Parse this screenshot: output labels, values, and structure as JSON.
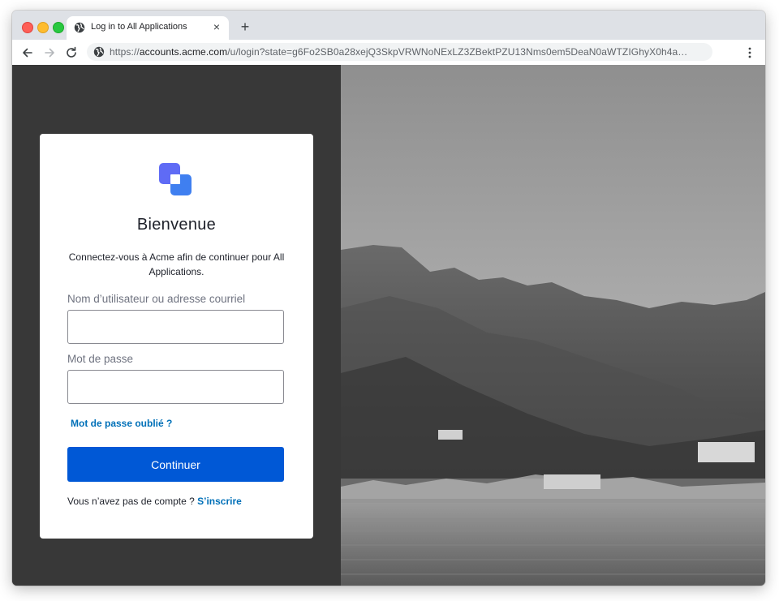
{
  "browser": {
    "tab_title": "Log in to All Applications",
    "close_tab_glyph": "×",
    "new_tab_glyph": "+",
    "url_prefix": "https://",
    "url_host": "accounts.acme.com",
    "url_path": "/u/login?state=g6Fo2SB0a28xejQ3SkpVRWNoNExLZ3ZBektPZU13Nms0em5DeaN0aWTZIGhyX0h4a…",
    "icons": [
      "globe-icon",
      "close-icon",
      "plus-icon",
      "back-arrow-icon",
      "forward-arrow-icon",
      "reload-icon",
      "kebab-menu-icon"
    ]
  },
  "login": {
    "logo": "acme-logo-icon",
    "title": "Bienvenue",
    "description": "Connectez-vous à Acme afin de continuer pour All Applications.",
    "username_label": "Nom d’utilisateur ou adresse courriel",
    "username_value": "",
    "password_label": "Mot de passe",
    "password_value": "",
    "forgot_password": "Mot de passe oublié ?",
    "continue_label": "Continuer",
    "no_account_text": "Vous n’avez pas de compte ?",
    "signup_link": "S’inscrire"
  },
  "colors": {
    "primary_button": "#0058d6",
    "link": "#0070b8",
    "left_panel_bg": "#383838",
    "logo_primary": "#3f59e4",
    "logo_secondary": "#5f6bf5"
  },
  "background_image": "black-and-white-photo-mountain-bay-beach-village"
}
